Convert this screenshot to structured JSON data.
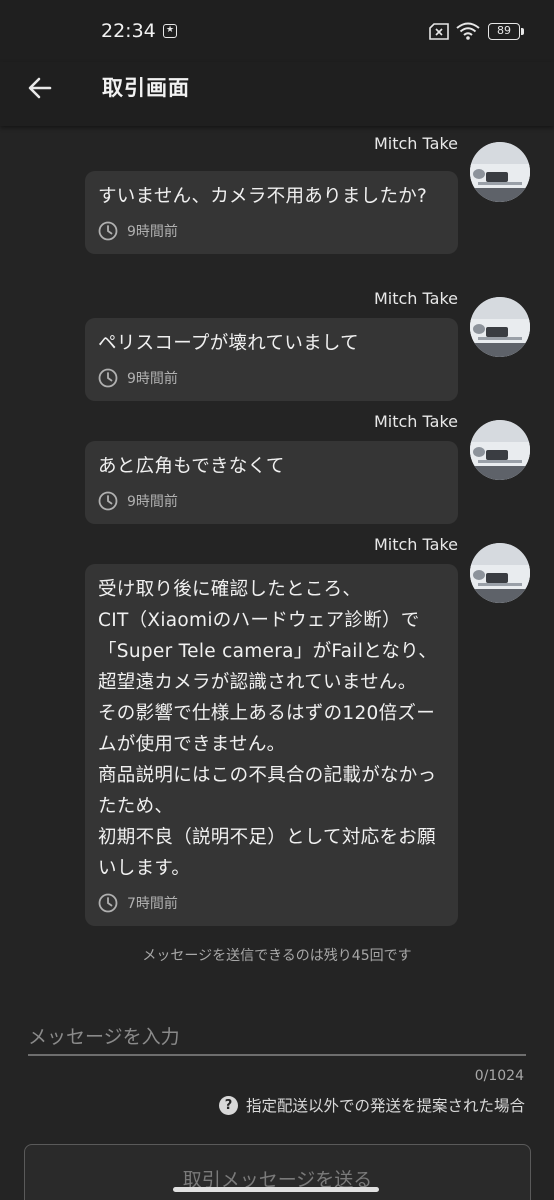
{
  "status_bar": {
    "time": "22:34",
    "battery": "89",
    "icons": [
      "notification-icon",
      "sim-off-icon",
      "wifi-icon",
      "battery-icon"
    ]
  },
  "app_bar": {
    "title": "取引画面",
    "back_icon": "arrow-left-icon"
  },
  "messages": [
    {
      "sender": "Mitch Take",
      "text": "すいません、カメラ不用ありましたか?",
      "time": "9時間前"
    },
    {
      "sender": "Mitch Take",
      "text": "ペリスコープが壊れていまして",
      "time": "9時間前"
    },
    {
      "sender": "Mitch Take",
      "text": "あと広角もできなくて",
      "time": "9時間前"
    },
    {
      "sender": "Mitch Take",
      "text": "受け取り後に確認したところ、\nCIT（Xiaomiのハードウェア診断）で「Super Tele camera」がFailとなり、\n超望遠カメラが認識されていません。\nその影響で仕様上あるはずの120倍ズームが使用できません。\n商品説明にはこの不具合の記載がなかったため、\n初期不良（説明不足）として対応をお願いします。",
      "time": "7時間前"
    }
  ],
  "remaining_notice": "メッセージを送信できるのは残り45回です",
  "composer": {
    "placeholder": "メッセージを入力",
    "value": "",
    "counter": "0/1024",
    "help_text": "指定配送以外での発送を提案された場合",
    "send_label": "取引メッセージを送る"
  },
  "colors": {
    "background": "#242424",
    "bubble": "#353535",
    "app_bar": "#1f1f1f"
  }
}
